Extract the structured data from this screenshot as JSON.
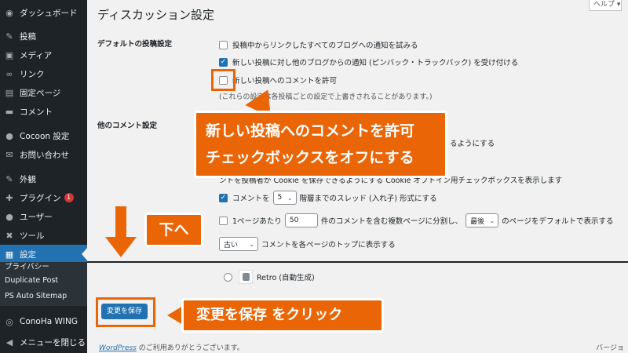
{
  "sidebar": {
    "items": [
      {
        "label": "ダッシュボード",
        "icon": "dashboard-icon",
        "glyph": "◉"
      },
      {
        "label": "投稿",
        "icon": "pin-icon",
        "glyph": "✎"
      },
      {
        "label": "メディア",
        "icon": "media-icon",
        "glyph": "▣"
      },
      {
        "label": "リンク",
        "icon": "link-icon",
        "glyph": "∞"
      },
      {
        "label": "固定ページ",
        "icon": "page-icon",
        "glyph": "▤"
      },
      {
        "label": "コメント",
        "icon": "comment-icon",
        "glyph": "▬"
      },
      {
        "label": "Cocoon 設定",
        "icon": "cocoon-icon",
        "glyph": "●"
      },
      {
        "label": "お問い合わせ",
        "icon": "mail-icon",
        "glyph": "✉"
      },
      {
        "label": "外観",
        "icon": "appearance-icon",
        "glyph": "✎"
      },
      {
        "label": "プラグイン",
        "icon": "plugin-icon",
        "glyph": "✚",
        "badge": "1"
      },
      {
        "label": "ユーザー",
        "icon": "user-icon",
        "glyph": "●"
      },
      {
        "label": "ツール",
        "icon": "tool-icon",
        "glyph": "✖"
      },
      {
        "label": "設定",
        "icon": "settings-icon",
        "glyph": "▦"
      }
    ],
    "sub_items": [
      {
        "label": "プライバシー"
      },
      {
        "label": "Duplicate Post"
      },
      {
        "label": "PS Auto Sitemap"
      }
    ],
    "bottom_items": [
      {
        "label": "ConoHa WING",
        "icon": "conoha-icon",
        "glyph": "◎"
      },
      {
        "label": "メニューを閉じる",
        "icon": "collapse-icon",
        "glyph": "◀"
      }
    ]
  },
  "header": {
    "title": "ディスカッション設定",
    "help": "ヘルプ ▾"
  },
  "form": {
    "default_settings_label": "デフォルトの投稿設定",
    "opt_pingback_notify": "投稿中からリンクしたすべてのブログへの通知を試みる",
    "opt_allow_pingbacks": "新しい投稿に対し他のブログからの通知 (ピンバック・トラックバック) を受け付ける",
    "opt_allow_comments": "新しい投稿へのコメントを許可",
    "desc_override": "(これらの設定は各投稿ごとの設定で上書きされることがあります。)",
    "other_comment_label": "他のコメント設定",
    "partial_text_1": "るようにする",
    "partial_text_2": "ントを投稿者が Cookie を保存できるようにする Cookie オプトイン用チェックボックスを表示します",
    "threaded_prefix": "コメントを",
    "threaded_value": "5",
    "threaded_suffix": "階層までのスレッド (入れ子) 形式にする",
    "paged_prefix": "1ページあたり",
    "paged_value": "50",
    "paged_middle": "件のコメントを含む複数ページに分割し、",
    "paged_select": "最後",
    "paged_suffix": "のページをデフォルトで表示する",
    "order_select": "古い",
    "order_suffix": "コメントを各ページのトップに表示する",
    "avatar_option": "Retro (自動生成)",
    "save_button": "変更を保存"
  },
  "footer": {
    "link": "WordPress",
    "text": " のご利用ありがとうございます。",
    "version": "バージョ"
  },
  "annotations": {
    "callout_line1": "新しい投稿へのコメントを許可",
    "callout_line2": "チェックボックスをオフにする",
    "down_label": "下へ",
    "save_label": "変更を保存 をクリック"
  },
  "colors": {
    "accent": "#ea6506",
    "primary": "#2271b1",
    "sidebar_bg": "#1d2327"
  }
}
